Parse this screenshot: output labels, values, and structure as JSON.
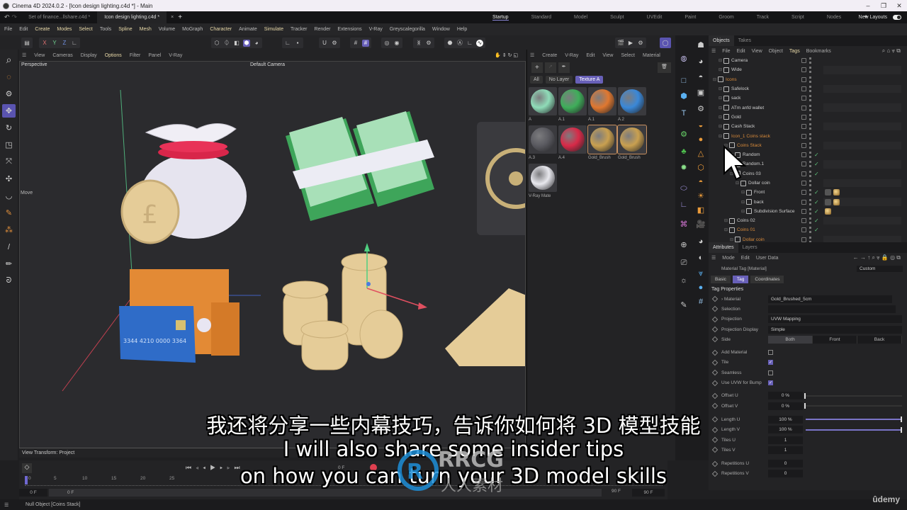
{
  "window": {
    "title": "Cinema 4D 2024.0.2 - [Icon design lighting.c4d *] - Main",
    "controls": [
      "minimize",
      "maximize",
      "close"
    ]
  },
  "doc_tabs": [
    {
      "label": "Set of finance...llshare.c4d *",
      "active": false
    },
    {
      "label": "Icon design lighting.c4d *",
      "active": true
    }
  ],
  "layouts": {
    "items": [
      "Startup",
      "Standard",
      "Model",
      "Sculpt",
      "UVEdit",
      "Paint",
      "Groom",
      "Track",
      "Script",
      "Nodes"
    ],
    "active": "Startup",
    "new_layouts_label": "New Layouts"
  },
  "menu": [
    "File",
    "Edit",
    "Create",
    "Modes",
    "Select",
    "Tools",
    "Spline",
    "Mesh",
    "Volume",
    "MoGraph",
    "Character",
    "Animate",
    "Simulate",
    "Tracker",
    "Render",
    "Extensions",
    "V-Ray",
    "Greyscalegorilla",
    "Window",
    "Help"
  ],
  "axis_buttons": [
    "X",
    "Y",
    "Z"
  ],
  "viewport": {
    "menu": [
      "View",
      "Cameras",
      "Display",
      "Options",
      "Filter",
      "Panel",
      "V-Ray"
    ],
    "highlighted_menu": "Options",
    "view_name": "Perspective",
    "camera": "Default Camera",
    "tool_label": "Move",
    "view_transform": "View Transform: Project",
    "card_number": "3344 4210 0000 3364"
  },
  "material_manager": {
    "menu": [
      "Create",
      "V-Ray",
      "Edit",
      "View",
      "Select",
      "Material"
    ],
    "layers": [
      "All",
      "No Layer",
      "Texture A"
    ],
    "active_layer": "Texture A",
    "materials": [
      {
        "name": "A",
        "color": "#8fdcb8"
      },
      {
        "name": "A.1",
        "color": "#3fae5a"
      },
      {
        "name": "A.1",
        "color": "#e07830"
      },
      {
        "name": "A.2",
        "color": "#3a88d8"
      },
      {
        "name": "A.3",
        "color": "#5a5a60"
      },
      {
        "name": "A.4",
        "color": "#d82a48"
      },
      {
        "name": "Gold_Brush",
        "color": "#c9a050"
      },
      {
        "name": "Gold_Brush",
        "color": "#c9a050"
      },
      {
        "name": "V-Ray Mate",
        "color": "#e8e8ee"
      }
    ]
  },
  "objects_panel": {
    "tabs": [
      "Objects",
      "Takes"
    ],
    "menu": [
      "File",
      "Edit",
      "View",
      "Object",
      "Tags",
      "Bookmarks"
    ],
    "rows": [
      {
        "name": "Camera",
        "indent": 1,
        "color": "normal"
      },
      {
        "name": "Wide",
        "indent": 1,
        "color": "normal"
      },
      {
        "name": "Icons",
        "indent": 0,
        "color": "orange"
      },
      {
        "name": "Safelock",
        "indent": 1,
        "color": "normal"
      },
      {
        "name": "sack",
        "indent": 1,
        "color": "normal"
      },
      {
        "name": "ATm anfd wallet",
        "indent": 1,
        "color": "normal"
      },
      {
        "name": "Gold",
        "indent": 1,
        "color": "normal"
      },
      {
        "name": "Cash Stack",
        "indent": 1,
        "color": "normal"
      },
      {
        "name": "Icon_1 Coins stack",
        "indent": 1,
        "color": "orange"
      },
      {
        "name": "Coins Stack",
        "indent": 2,
        "color": "orange"
      },
      {
        "name": "Random",
        "indent": 3,
        "color": "normal",
        "check": true
      },
      {
        "name": "Random.1",
        "indent": 3,
        "color": "normal",
        "check": true
      },
      {
        "name": "Coins 03",
        "indent": 3,
        "color": "normal",
        "check": true
      },
      {
        "name": "Dollar coin",
        "indent": 4,
        "color": "normal"
      },
      {
        "name": "Front",
        "indent": 5,
        "color": "normal",
        "check": true,
        "tags": 2
      },
      {
        "name": "back",
        "indent": 5,
        "color": "normal",
        "check": true,
        "tags": 2
      },
      {
        "name": "Subdivision Surface",
        "indent": 5,
        "color": "normal",
        "check": true,
        "tags": 1
      },
      {
        "name": "Coins 02",
        "indent": 2,
        "color": "normal",
        "check": true
      },
      {
        "name": "Coins 01",
        "indent": 2,
        "color": "orange",
        "check": true
      },
      {
        "name": "Dollar coin",
        "indent": 3,
        "color": "orange"
      }
    ]
  },
  "attributes": {
    "tabs": [
      "Attributes",
      "Layers"
    ],
    "menu": [
      "Mode",
      "Edit",
      "User Data"
    ],
    "object_label": "Material Tag [Material]",
    "preset": "Custom",
    "subtabs": [
      "Basic",
      "Tag",
      "Coordinates"
    ],
    "active_subtab": "Tag",
    "section": "Tag Properties",
    "material": {
      "label": "Material",
      "value": "Gold_Brushed_5cm"
    },
    "selection": {
      "label": "Selection",
      "value": ""
    },
    "projection": {
      "label": "Projection",
      "value": "UVW Mapping"
    },
    "projection_display": {
      "label": "Projection Display",
      "value": "Simple"
    },
    "side": {
      "label": "Side",
      "options": [
        "Both",
        "Front",
        "Back"
      ],
      "value": "Both"
    },
    "checkboxes": [
      {
        "label": "Add Material",
        "checked": false
      },
      {
        "label": "Tile",
        "checked": true
      },
      {
        "label": "Seamless",
        "checked": false
      },
      {
        "label": "Use UVW for Bump",
        "checked": true
      }
    ],
    "sliders": [
      {
        "label": "Offset U",
        "value": "0 %",
        "fraction": 0
      },
      {
        "label": "Offset V",
        "value": "0 %",
        "fraction": 0
      },
      {
        "label": "Length U",
        "value": "100 %",
        "fraction": 1
      },
      {
        "label": "Length V",
        "value": "100 %",
        "fraction": 1
      }
    ],
    "numbers": [
      {
        "label": "Tiles U",
        "value": "1"
      },
      {
        "label": "Tiles V",
        "value": "1"
      },
      {
        "label": "Repetitions U",
        "value": "0"
      },
      {
        "label": "Repetitions V",
        "value": "0"
      }
    ]
  },
  "timeline": {
    "ticks": [
      "0",
      "5",
      "10",
      "15",
      "20",
      "25"
    ],
    "current_frame": "0 F",
    "start": "0 F",
    "start2": "0 F",
    "end": "90 F",
    "end2": "90 F"
  },
  "status": "Null Object [Coins Stack]",
  "subtitles": {
    "zh": "我还将分享一些内幕技巧，告诉你如何将 3D 模型技能",
    "en1": "I will also share some insider tips",
    "en2": "on how you can turn your 3D model skills"
  },
  "watermark": {
    "brand": "RRCG",
    "sub": "人人素材"
  },
  "udemy": "ûdemy"
}
